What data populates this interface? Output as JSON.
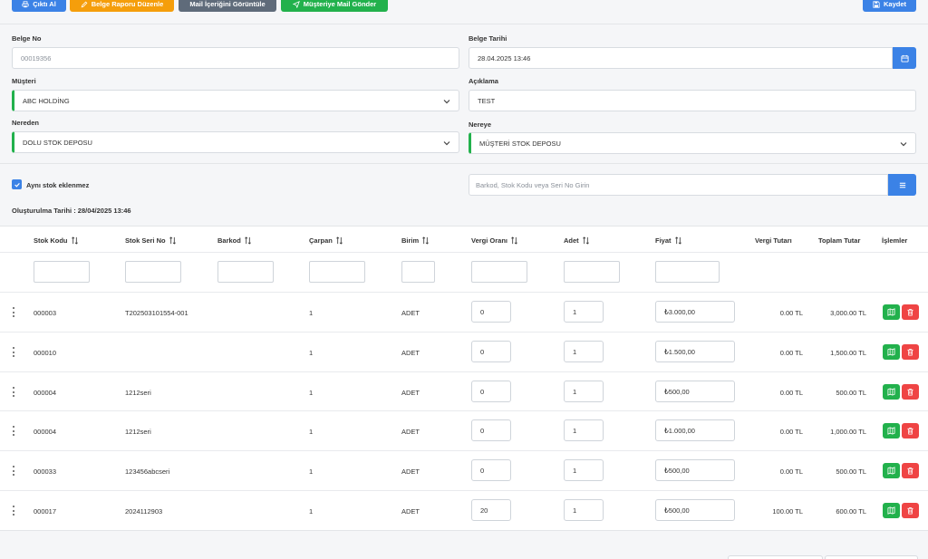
{
  "toolbar": {
    "print_label": "Çıktı Al",
    "edit_report_label": "Belge Raporu Düzenle",
    "view_mail_label": "Mail İçeriğini Görüntüle",
    "send_mail_label": "Müşteriye Mail Gönder",
    "save_label": "Kaydet"
  },
  "form": {
    "belge_no_label": "Belge No",
    "belge_no_value": "00019356",
    "belge_tarihi_label": "Belge Tarihi",
    "belge_tarihi_value": "28.04.2025 13:46",
    "musteri_label": "Müşteri",
    "musteri_value": "ABC HOLDİNG",
    "aciklama_label": "Açıklama",
    "aciklama_value": "TEST",
    "nereden_label": "Nereden",
    "nereden_value": "DOLU STOK DEPOSU",
    "nereye_label": "Nereye",
    "nereye_value": "MÜŞTERİ STOK DEPOSU"
  },
  "options": {
    "ayni_stok_label": "Aynı stok eklenmez",
    "ayni_stok_checked": true,
    "search_placeholder": "Barkod, Stok Kodu veya Seri No Girin",
    "created_text": "Oluşturulma Tarihi : 28/04/2025 13:46"
  },
  "table": {
    "headers": {
      "stok_kodu": "Stok Kodu",
      "stok_seri_no": "Stok Seri No",
      "barkod": "Barkod",
      "carpan": "Çarpan",
      "birim": "Birim",
      "vergi_orani": "Vergi Oranı",
      "adet": "Adet",
      "fiyat": "Fiyat",
      "vergi_tutari": "Vergi Tutarı",
      "toplam_tutar": "Toplam Tutar",
      "islemler": "İşlemler"
    },
    "rows": [
      {
        "stok_kodu": "000003",
        "seri_no": "T202503101554-001",
        "barkod": "",
        "carpan": "1",
        "birim": "ADET",
        "vergi_orani": "0",
        "adet": "1",
        "fiyat": "₺3.000,00",
        "vergi_tutari": "0.00 TL",
        "toplam_tutar": "3,000.00 TL"
      },
      {
        "stok_kodu": "000010",
        "seri_no": "",
        "barkod": "",
        "carpan": "1",
        "birim": "ADET",
        "vergi_orani": "0",
        "adet": "1",
        "fiyat": "₺1.500,00",
        "vergi_tutari": "0.00 TL",
        "toplam_tutar": "1,500.00 TL"
      },
      {
        "stok_kodu": "000004",
        "seri_no": "1212seri",
        "barkod": "",
        "carpan": "1",
        "birim": "ADET",
        "vergi_orani": "0",
        "adet": "1",
        "fiyat": "₺500,00",
        "vergi_tutari": "0.00 TL",
        "toplam_tutar": "500.00 TL"
      },
      {
        "stok_kodu": "000004",
        "seri_no": "1212seri",
        "barkod": "",
        "carpan": "1",
        "birim": "ADET",
        "vergi_orani": "0",
        "adet": "1",
        "fiyat": "₺1.000,00",
        "vergi_tutari": "0.00 TL",
        "toplam_tutar": "1,000.00 TL"
      },
      {
        "stok_kodu": "000033",
        "seri_no": "123456abcseri",
        "barkod": "",
        "carpan": "1",
        "birim": "ADET",
        "vergi_orani": "0",
        "adet": "1",
        "fiyat": "₺500,00",
        "vergi_tutari": "0.00 TL",
        "toplam_tutar": "500.00 TL"
      },
      {
        "stok_kodu": "000017",
        "seri_no": "2024112903",
        "barkod": "",
        "carpan": "1",
        "birim": "ADET",
        "vergi_orani": "20",
        "adet": "1",
        "fiyat": "₺500,00",
        "vergi_tutari": "100.00 TL",
        "toplam_tutar": "600.00 TL"
      }
    ]
  },
  "icons": {
    "print": "printer-icon",
    "edit": "pencil-icon",
    "view": "eye-icon",
    "send": "paper-plane-icon",
    "save": "floppy-disk-icon",
    "calendar": "calendar-icon",
    "dropdown": "chevron-down-icon",
    "check": "check-icon",
    "list": "list-icon",
    "sort": "sort-arrows-icon",
    "row_menu": "vertical-dots-icon",
    "detail": "map-icon",
    "delete": "trash-icon"
  },
  "colors": {
    "primary": "#3b82e6",
    "warning": "#f59e0b",
    "secondary": "#5f6b7a",
    "success": "#22b14c",
    "danger": "#ef4444"
  }
}
